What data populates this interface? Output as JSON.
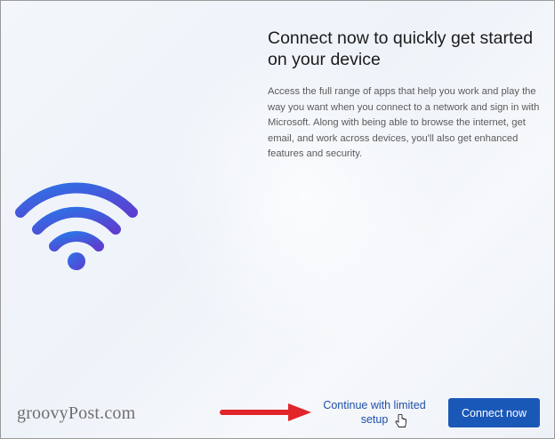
{
  "main": {
    "title": "Connect now to quickly get started on your device",
    "description": "Access the full range of apps that help you work and play the way you want when you connect to a network and sign in with Microsoft. Along with being able to browse the internet, get email, and work across devices, you'll also get enhanced features and security."
  },
  "footer": {
    "limited_setup_label": "Continue with limited setup",
    "connect_now_label": "Connect now"
  },
  "watermark": "groovyPost.com",
  "icons": {
    "wifi": "wifi-icon",
    "arrow": "red-arrow-icon",
    "cursor": "hand-cursor-icon"
  },
  "colors": {
    "accent": "#1a58b8",
    "link": "#1f4fa8",
    "wifi_gradient_start": "#2d73e6",
    "wifi_gradient_end": "#5b3fd0",
    "arrow": "#e2252b"
  }
}
